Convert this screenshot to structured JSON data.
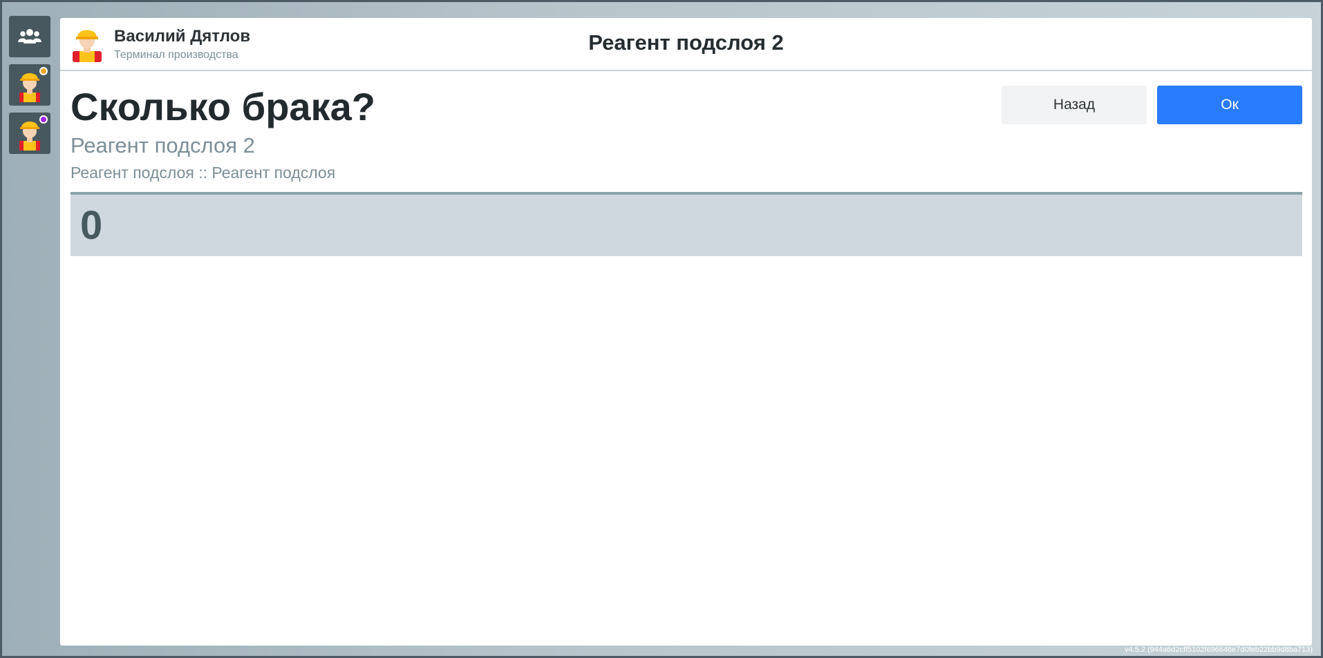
{
  "app": {
    "user_name": "Василий Дятлов",
    "user_role": "Терминал производства",
    "screen_title": "Реагент подслоя 2"
  },
  "sidebar": {
    "items": [
      {
        "icon": "users-group-icon"
      },
      {
        "icon": "worker-avatar-icon",
        "badge_color": "#f5a623"
      },
      {
        "icon": "worker-avatar-icon",
        "badge_color": "#a020f0"
      }
    ]
  },
  "main": {
    "question": "Сколько брака?",
    "subtitle": "Реагент подслоя 2",
    "path": "Реагент подслоя :: Реагент подслоя",
    "value": "0"
  },
  "actions": {
    "back_label": "Назад",
    "ok_label": "Ок"
  },
  "footer": {
    "version": "v4.5.2 (944a6d2cff5102f696646e7d0feb22bb9d8ba713)"
  },
  "colors": {
    "accent": "#2a7cff",
    "sidebar_bg": "#48585f",
    "value_bg": "#d0d8df"
  }
}
